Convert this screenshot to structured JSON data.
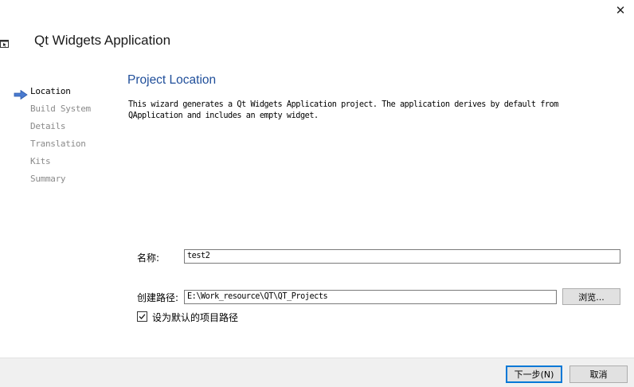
{
  "window": {
    "title": "Qt Widgets Application",
    "close_glyph": "✕"
  },
  "steps": [
    {
      "label": "Location",
      "active": true
    },
    {
      "label": "Build System",
      "active": false
    },
    {
      "label": "Details",
      "active": false
    },
    {
      "label": "Translation",
      "active": false
    },
    {
      "label": "Kits",
      "active": false
    },
    {
      "label": "Summary",
      "active": false
    }
  ],
  "page": {
    "title": "Project Location",
    "description_line1": "This wizard generates a Qt Widgets Application project. The application derives by default from",
    "description_line2": "QApplication and includes an empty widget."
  },
  "form": {
    "name_label": "名称:",
    "name_value": "test2",
    "path_label": "创建路径:",
    "path_value": "E:\\Work_resource\\QT\\QT_Projects",
    "browse_label": "浏览...",
    "default_checkbox_label": "设为默认的项目路径",
    "default_checked": true
  },
  "footer": {
    "next_label": "下一步(N)",
    "cancel_label": "取消"
  },
  "colors": {
    "accent": "#1f4e9a",
    "arrow": "#4a7bd0",
    "primary_border": "#0078d7"
  },
  "icons": {
    "arrow": "step-arrow-icon",
    "app": "app-icon",
    "close": "close-icon",
    "check": "checkmark-icon"
  }
}
